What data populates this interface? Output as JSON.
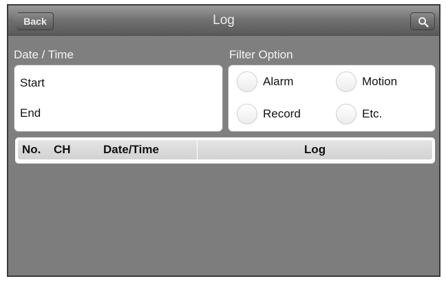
{
  "navbar": {
    "back_label": "Back",
    "title": "Log",
    "search_icon": "magnifier-icon"
  },
  "date_section": {
    "label": "Date / Time",
    "start_label": "Start",
    "end_label": "End"
  },
  "filter_section": {
    "label": "Filter Option",
    "options": [
      {
        "label": "Alarm",
        "selected": false
      },
      {
        "label": "Motion",
        "selected": false
      },
      {
        "label": "Record",
        "selected": false
      },
      {
        "label": "Etc.",
        "selected": false
      }
    ]
  },
  "table": {
    "columns": [
      "No.",
      "CH",
      "Date/Time",
      "Log"
    ],
    "rows": []
  },
  "colors": {
    "navbar": "#6f6f6f",
    "background": "#7f7f7f",
    "panel": "#ffffff",
    "header_bar": "#d8d8d8"
  }
}
